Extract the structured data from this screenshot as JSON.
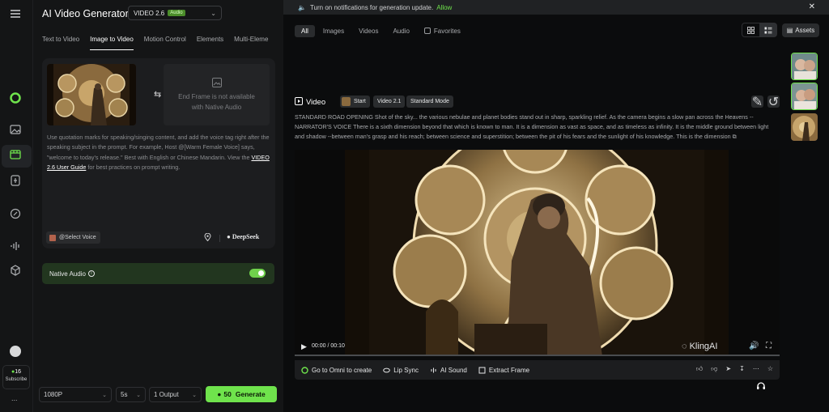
{
  "rail": {
    "credits": "16",
    "subscribe": "Subscribe",
    "more": "..."
  },
  "header": {
    "title": "AI Video Generator",
    "version": "VIDEO 2.6",
    "version_badge": "Audio"
  },
  "tabs": [
    "Text to Video",
    "Image to Video",
    "Motion Control",
    "Elements",
    "Multi-Eleme"
  ],
  "active_tab": "Image to Video",
  "end_frame": {
    "line1": "End Frame is not available",
    "line2": "with Native Audio"
  },
  "prompt": {
    "text": "Use quotation marks for speaking/singing content, and add the voice tag right after the speaking subject in the prompt. For example, Host @[Warm Female Voice] says, \"welcome to today's release.\" Best with English or Chinese Mandarin. View the",
    "link": "VIDEO 2.6 User Guide",
    "suffix": "for best practices on prompt writing."
  },
  "voice_button": "@Select Voice",
  "deepseek": "DeepSeek",
  "native_audio": {
    "label": "Native Audio",
    "enabled": true
  },
  "bottom": {
    "resolution": "1080P",
    "duration": "5s",
    "outputs": "1 Output",
    "gen_cost": "50",
    "gen_label": "Generate"
  },
  "notification": {
    "text": "Turn on notifications for generation update.",
    "action": "Allow"
  },
  "filters": {
    "items": [
      "All",
      "Images",
      "Videos",
      "Audio"
    ],
    "active": "All",
    "favorites": "Favorites"
  },
  "assets_label": "Assets",
  "video_card": {
    "label": "Video",
    "chip_start": "Start",
    "chip_model": "Video 2.1",
    "chip_mode": "Standard Mode",
    "description": "STANDARD ROAD OPENING Shot of the sky... the various nebulae and planet bodies stand out in sharp, sparkling relief. As the camera begins a slow pan across the Heavens -- NARRATOR'S VOICE There is a sixth dimension beyond that which is known to man. It is a dimension as vast as space, and as timeless as infinity. It is the middle ground between light and shadow --between man's grasp and his reach; between science and superstition; between the pit of his fears and the sunlight of his knowledge. This is the dimension",
    "time": "00:00 / 00:10",
    "watermark": "KlingAI",
    "progress": 0
  },
  "actions": {
    "omni": "Go to Omni to create",
    "lipsync": "Lip Sync",
    "aisound": "AI Sound",
    "extract": "Extract Frame"
  },
  "colors": {
    "accent": "#6fe34c",
    "bg": "#0b0c0d",
    "panel": "#141516"
  }
}
